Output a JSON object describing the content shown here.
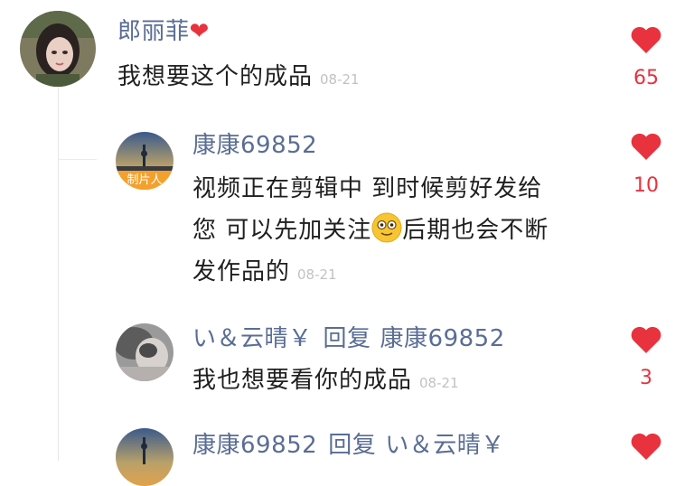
{
  "colors": {
    "username": "#5a6d95",
    "text": "#1f1f1f",
    "timestamp": "#c2c2c2",
    "like": "#e8323e"
  },
  "comments": [
    {
      "username": "郎丽菲",
      "name_suffix_icon": "red-heart-emoji",
      "lines": [
        "我想要这个的成品"
      ],
      "time": "08-21",
      "likes": "65",
      "avatar_icon": "girl-selfie-avatar"
    },
    {
      "username": "康康69852",
      "avatar_badge": "制片人",
      "avatar_icon": "city-tower-avatar",
      "lines": [
        "视频正在剪辑中 到时候剪好发给",
        "您 可以先加关注",
        "后期也会不断",
        "发作品的"
      ],
      "time": "08-21",
      "likes": "10",
      "emoji_icon": "smiling-face-emoji"
    },
    {
      "username": "い＆云晴￥",
      "reply_word": "回复",
      "reply_to": "康康69852",
      "avatar_icon": "blurry-person-avatar",
      "lines": [
        "我也想要看你的成品"
      ],
      "time": "08-21",
      "likes": "3"
    },
    {
      "username": "康康69852",
      "reply_word": "回复",
      "reply_to": "い＆云晴￥",
      "avatar_icon": "city-tower-avatar"
    }
  ]
}
